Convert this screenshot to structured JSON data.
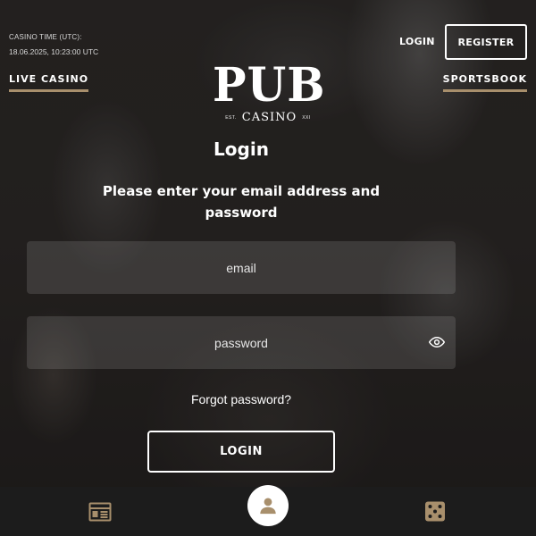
{
  "header": {
    "casino_time_label": "CASINO TIME (UTC):",
    "casino_time_value": "18.06.2025, 10:23:00 UTC",
    "live_casino": "LIVE CASINO",
    "sportsbook": "SPORTSBOOK",
    "login_link": "LOGIN",
    "register_button": "REGISTER"
  },
  "logo": {
    "name": "PUB",
    "sub": "CASINO",
    "est": "EST.",
    "year": "XXI"
  },
  "form": {
    "title": "Login",
    "instructions": "Please enter your email address and password",
    "email_placeholder": "email",
    "password_placeholder": "password",
    "forgot": "Forgot password?",
    "submit": "LOGIN"
  },
  "bottom_nav": {
    "items": [
      {
        "icon": "calendar-grid-icon"
      },
      {
        "icon": "user-icon",
        "active": true
      },
      {
        "icon": "dice-icon"
      }
    ]
  },
  "colors": {
    "accent": "#a88f6c",
    "bottom_bar": "#1c1c1c"
  }
}
